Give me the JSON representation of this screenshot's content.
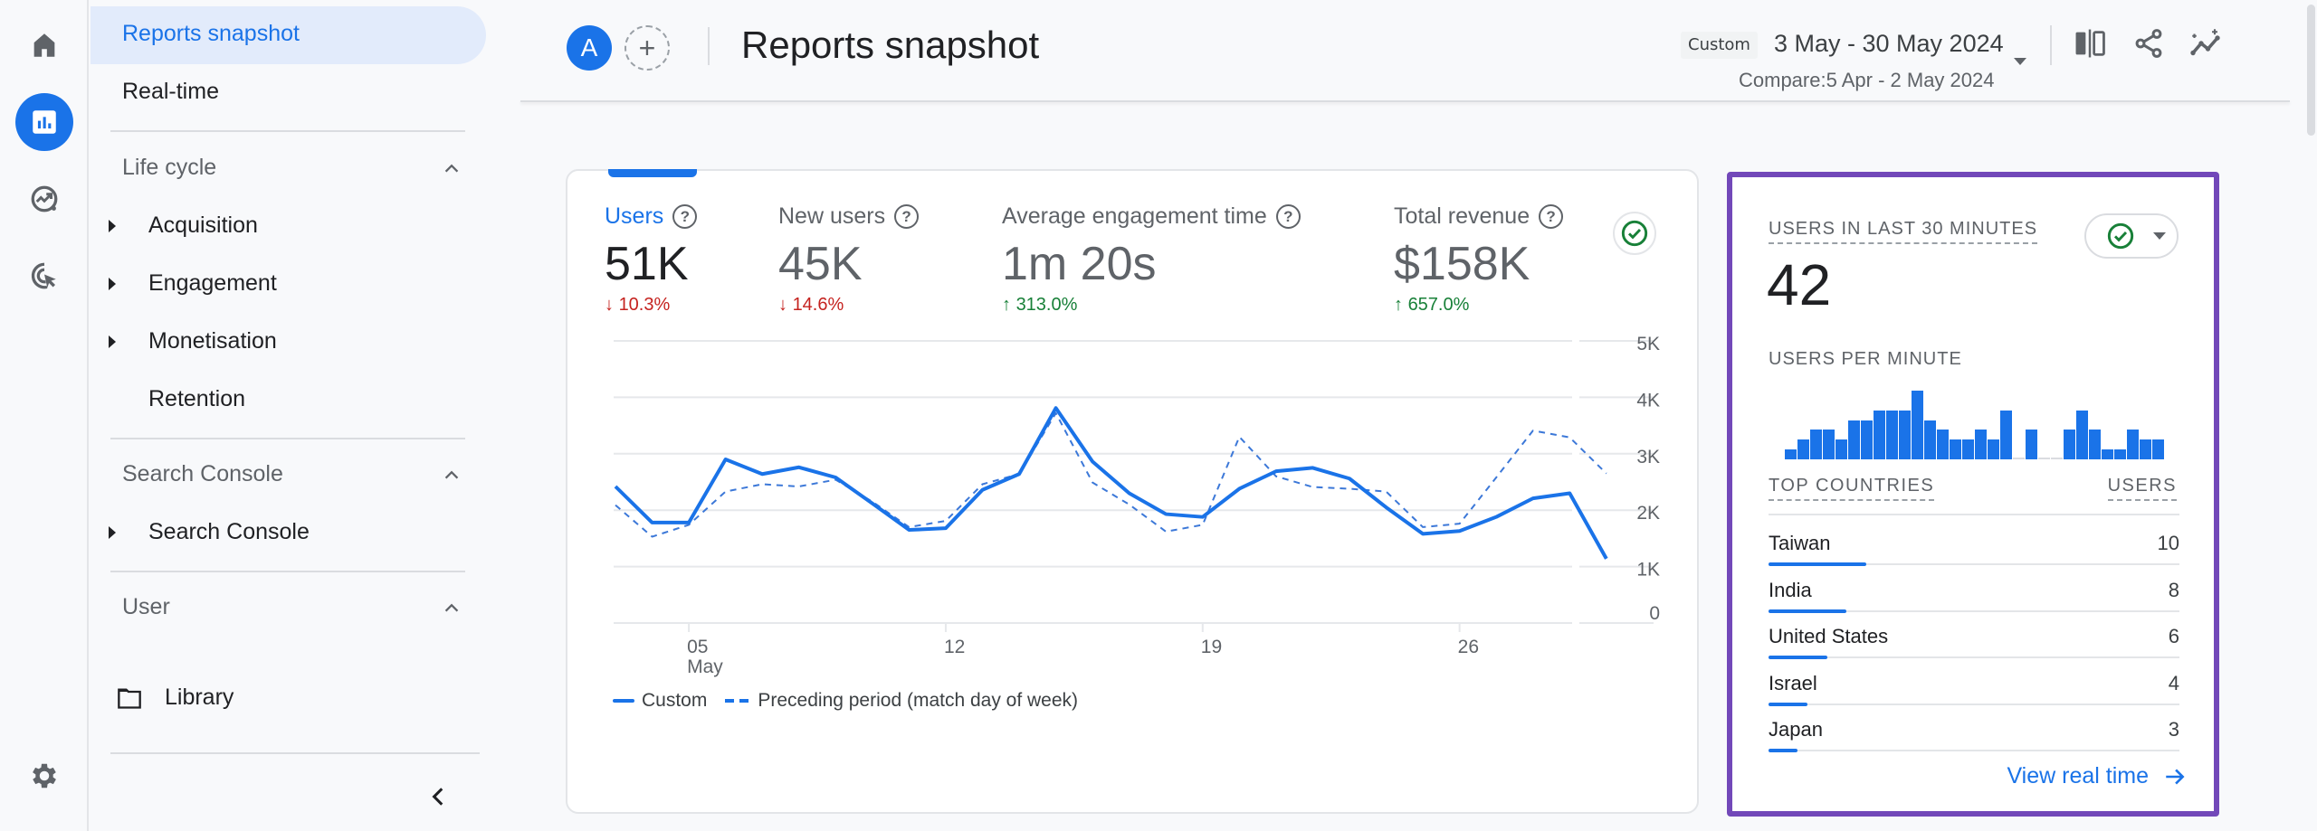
{
  "rail": {
    "items": [
      {
        "icon": "home-icon",
        "label": "Home"
      },
      {
        "icon": "reports-icon",
        "label": "Reports",
        "active": true
      },
      {
        "icon": "explore-icon",
        "label": "Explore"
      },
      {
        "icon": "advertising-icon",
        "label": "Advertising"
      }
    ],
    "settings_icon": "gear-icon"
  },
  "sidebar": {
    "top_items": [
      {
        "label": "Reports snapshot",
        "active": true
      },
      {
        "label": "Real-time"
      }
    ],
    "sections": [
      {
        "title": "Life cycle",
        "items": [
          "Acquisition",
          "Engagement",
          "Monetisation",
          "Retention"
        ]
      },
      {
        "title": "Search Console",
        "items": [
          "Search Console"
        ]
      },
      {
        "title": "User",
        "items": []
      }
    ],
    "library_label": "Library",
    "collapse_icon": "chevron-left-icon"
  },
  "header": {
    "avatar_letter": "A",
    "add_compare_symbol": "+",
    "title": "Reports snapshot",
    "date_chip": "Custom",
    "date_range": "3 May - 30 May 2024",
    "compare_range": "Compare:5 Apr - 2 May 2024",
    "actions": [
      "compare-icon",
      "share-icon",
      "insights-icon"
    ]
  },
  "metrics": [
    {
      "label": "Users",
      "value": "51K",
      "change": "10.3%",
      "direction": "down",
      "selected": true
    },
    {
      "label": "New users",
      "value": "45K",
      "change": "14.6%",
      "direction": "down"
    },
    {
      "label": "Average engagement time",
      "value": "1m 20s",
      "change": "313.0%",
      "direction": "up"
    },
    {
      "label": "Total revenue",
      "value": "$158K",
      "change": "657.0%",
      "direction": "up"
    }
  ],
  "arrows": {
    "down": "↓",
    "up": "↑"
  },
  "help_symbol": "?",
  "chart_data": {
    "type": "line",
    "title": "",
    "xlabel": "",
    "ylabel": "",
    "x": [
      "3 May",
      "4 May",
      "5 May",
      "6 May",
      "7 May",
      "8 May",
      "9 May",
      "10 May",
      "11 May",
      "12 May",
      "13 May",
      "14 May",
      "15 May",
      "16 May",
      "17 May",
      "18 May",
      "19 May",
      "20 May",
      "21 May",
      "22 May",
      "23 May",
      "24 May",
      "25 May",
      "26 May",
      "27 May",
      "28 May",
      "29 May",
      "30 May"
    ],
    "x_ticks": [
      {
        "index": 2,
        "label": "05",
        "sublabel": "May"
      },
      {
        "index": 9,
        "label": "12"
      },
      {
        "index": 16,
        "label": "19"
      },
      {
        "index": 23,
        "label": "26"
      }
    ],
    "y_ticks": [
      {
        "value": 0,
        "label": "0"
      },
      {
        "value": 1000,
        "label": "1K"
      },
      {
        "value": 2000,
        "label": "2K"
      },
      {
        "value": 3000,
        "label": "3K"
      },
      {
        "value": 4000,
        "label": "4K"
      },
      {
        "value": 5000,
        "label": "5K"
      }
    ],
    "ylim": [
      0,
      5000
    ],
    "grid": true,
    "legend_position": "bottom-left",
    "series": [
      {
        "name": "Custom",
        "style": "solid",
        "color": "#1a73e8",
        "values": [
          2420,
          1780,
          1780,
          2900,
          2640,
          2760,
          2580,
          2120,
          1650,
          1680,
          2360,
          2640,
          3810,
          2860,
          2300,
          1930,
          1880,
          2380,
          2690,
          2750,
          2560,
          2050,
          1580,
          1630,
          1880,
          2210,
          2300,
          1140
        ]
      },
      {
        "name": "Preceding period (match day of week)",
        "style": "dashed",
        "color": "#1a73e8",
        "values": [
          2090,
          1530,
          1740,
          2330,
          2460,
          2420,
          2540,
          2150,
          1700,
          1810,
          2460,
          2640,
          3720,
          2490,
          2100,
          1620,
          1740,
          3300,
          2600,
          2410,
          2380,
          2330,
          1700,
          1760,
          2580,
          3410,
          3290,
          2650
        ]
      }
    ]
  },
  "realtime": {
    "title": "USERS IN LAST 30 MINUTES",
    "value": "42",
    "status_icon": "check-circle-icon",
    "per_minute_title": "USERS PER MINUTE",
    "per_minute": [
      1,
      2,
      3,
      3,
      2,
      4,
      4,
      5,
      5,
      5,
      7,
      4,
      3,
      2,
      2,
      3,
      2,
      5,
      0,
      3,
      0,
      0,
      3,
      5,
      3,
      1,
      1,
      3,
      2,
      2
    ],
    "countries_header": "TOP COUNTRIES",
    "users_header": "USERS",
    "countries": [
      {
        "name": "Taiwan",
        "users": 10
      },
      {
        "name": "India",
        "users": 8
      },
      {
        "name": "United States",
        "users": 6
      },
      {
        "name": "Israel",
        "users": 4
      },
      {
        "name": "Japan",
        "users": 3
      }
    ],
    "total_users": 42,
    "view_link": "View real time"
  },
  "colors": {
    "accent": "#1a73e8",
    "highlight_border": "#7248b9",
    "down": "#c5221f",
    "up": "#188038"
  }
}
